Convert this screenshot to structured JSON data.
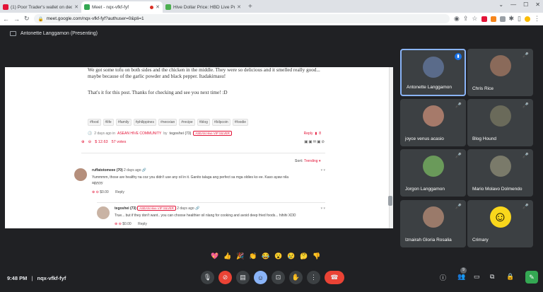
{
  "browser": {
    "tabs": [
      {
        "title": "(1) Poor Trader's wallet on dece",
        "fav": "#e31337"
      },
      {
        "title": "Meet - nqx-vfkf-fyf",
        "fav": "#34a853"
      },
      {
        "title": "Hive Dollar Price: HBD Live Pric",
        "fav": "#4caf50"
      }
    ],
    "url": "meet.google.com/nqx-vfkf-fyf?authuser=0&pli=1"
  },
  "meet": {
    "presenter": "Antonette Langgamon (Presenting)",
    "time": "9:48 PM",
    "separator": "|",
    "meeting_code": "nqx-vfkf-fyf",
    "participant_count": "9",
    "participants": [
      {
        "name": "Antonette Langgamon",
        "color": "#5a6b8a"
      },
      {
        "name": "Chris Rice",
        "color": "#8a6a5a"
      },
      {
        "name": "joyce venus acasio",
        "color": "#a67a6a"
      },
      {
        "name": "Blog Hound",
        "color": "#6a6a5a"
      },
      {
        "name": "Jorgon Langgamon",
        "color": "#6a9a5a"
      },
      {
        "name": "Mario Molavo Dolmendo",
        "color": "#7a7a6a"
      },
      {
        "name": "Iznairah Gloria Rosalia",
        "color": "#9a7a6a"
      },
      {
        "name": "Crimary",
        "color": "#f9d71c"
      }
    ],
    "reactions": [
      "💖",
      "👍",
      "🎉",
      "👏",
      "😂",
      "😮",
      "😢",
      "🤔",
      "👎"
    ]
  },
  "post": {
    "paragraph1": "We got some tofu on both sides and the chicken in the middle. They were so delicious and it smelled really good... maybe because of the garlic powder and black pepper. Itadakimasu!",
    "paragraph2": "That's it for this post. Thanks for checking and see you next time! :D",
    "tags": [
      "#food",
      "#life",
      "#family",
      "#philippines",
      "#neoxian",
      "#recipe",
      "#blog",
      "#bilpcoin",
      "#foodie"
    ],
    "meta_time": "2 days ago in",
    "community": "ASEAN HIVE COMMUNITY",
    "by": "by",
    "author": "tegoshei (73)",
    "author_badge": "ASEAN Hive VIP SILVER",
    "reply": "Reply",
    "reply_count": "8",
    "payout": "$ 12.63",
    "votes": "57 votes",
    "sort_label": "Sort:",
    "sort_value": "Trending"
  },
  "comments": [
    {
      "author": "ruffatotomeee (70)",
      "time": "2 days ago",
      "body1": "Yummmm, those are healthy na coz you didn't use any oil in it. Ganito talaga ang perfect sa mga oldies ko ee. Kaso ayaw nila",
      "body2": "agyyyy",
      "payout": "$0.00",
      "reply": "Reply"
    },
    {
      "author": "tegoshei (73)",
      "badge": "ASEAN Hive VIP SILVER",
      "time": "2 days ago",
      "body1": "True... but if they don't want.. you can choose healthier oil nlang for cooking and avoid deep fried foods... hihihi XDD",
      "payout": "$0.00",
      "reply": "Reply"
    }
  ]
}
